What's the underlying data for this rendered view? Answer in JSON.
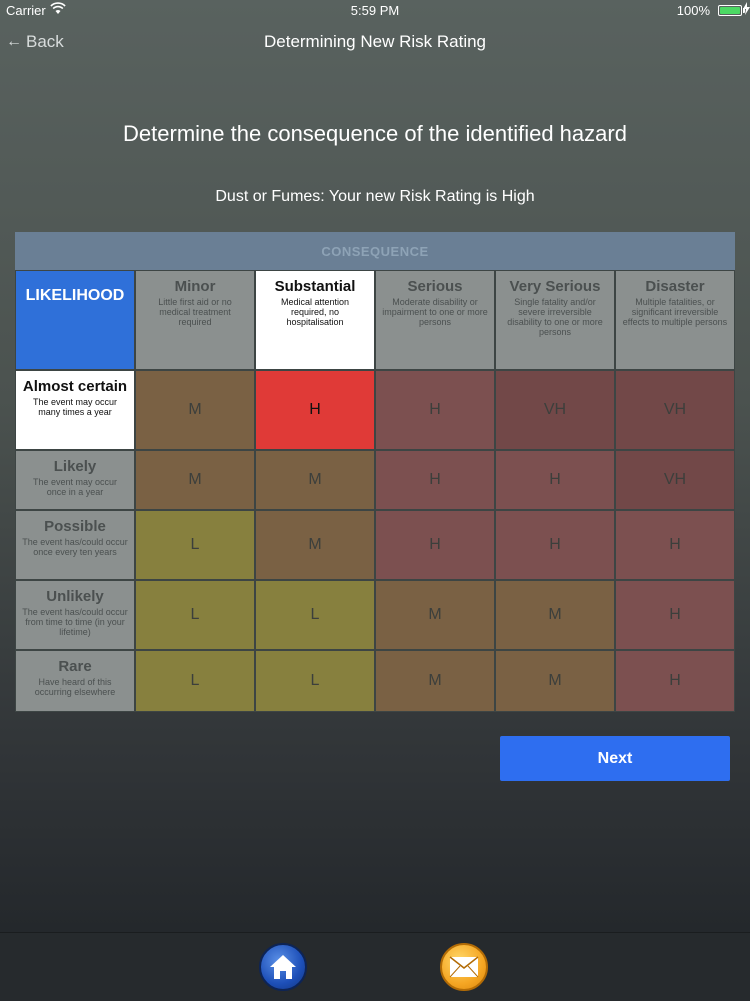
{
  "status_bar": {
    "carrier": "Carrier",
    "time": "5:59 PM",
    "battery": "100%"
  },
  "nav": {
    "back_label": "Back",
    "title": "Determining New Risk Rating"
  },
  "heading": "Determine the consequence of the identified hazard",
  "subheading": "Dust or Fumes: Your new Risk Rating is High",
  "matrix": {
    "consequence_label": "CONSEQUENCE",
    "likelihood_label": "LIKELIHOOD",
    "columns": [
      {
        "title": "Minor",
        "desc": "Little first aid or no medical treatment required"
      },
      {
        "title": "Substantial",
        "desc": "Medical attention required, no hospitalisation"
      },
      {
        "title": "Serious",
        "desc": "Moderate disability or impairment to one or more persons"
      },
      {
        "title": "Very Serious",
        "desc": "Single fatality and/or severe irreversible disability to one or more persons"
      },
      {
        "title": "Disaster",
        "desc": "Multiple fatalities, or significant irreversible effects to multiple persons"
      }
    ],
    "rows": [
      {
        "title": "Almost certain",
        "desc": "The event may occur many times a year",
        "ratings": [
          "M",
          "H",
          "H",
          "VH",
          "VH"
        ]
      },
      {
        "title": "Likely",
        "desc": "The event may occur once in a year",
        "ratings": [
          "M",
          "M",
          "H",
          "H",
          "VH"
        ]
      },
      {
        "title": "Possible",
        "desc": "The event has/could occur once every ten years",
        "ratings": [
          "L",
          "M",
          "H",
          "H",
          "H"
        ]
      },
      {
        "title": "Unlikely",
        "desc": "The event has/could occur from time to time (in your lifetime)",
        "ratings": [
          "L",
          "L",
          "M",
          "M",
          "H"
        ]
      },
      {
        "title": "Rare",
        "desc": "Have heard of this occurring elsewhere",
        "ratings": [
          "L",
          "L",
          "M",
          "M",
          "H"
        ]
      }
    ],
    "selected_row": 0,
    "selected_column": 1
  },
  "next_label": "Next",
  "tab_bar": {
    "home_icon": "home-icon",
    "mail_icon": "envelope-icon"
  },
  "colors": {
    "likelihood_header": "#2f70d9",
    "selected_cell": "#e03a37",
    "next_button": "#2e6ef0",
    "low": "#87803e",
    "medium": "#7a6144",
    "high": "#7c5050",
    "very_high": "#724848"
  }
}
